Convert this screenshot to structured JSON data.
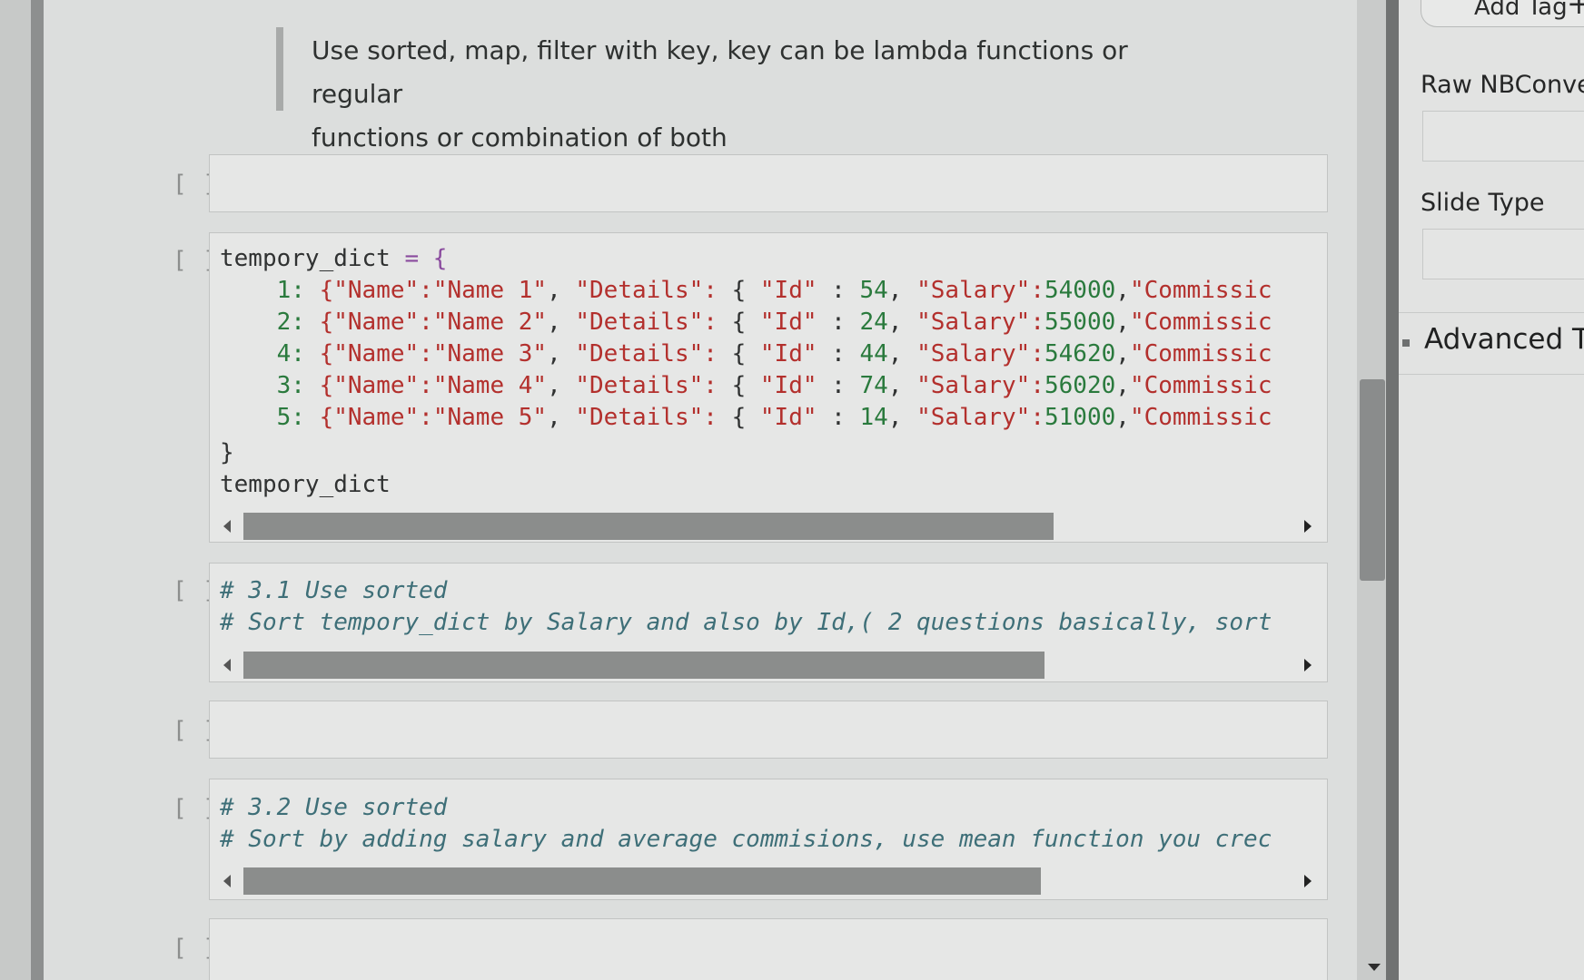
{
  "markdown": {
    "line1": "Use sorted, map, filter with key, key can be lambda functions or regular",
    "line2": "functions or combination of both"
  },
  "prompts": [
    "[ ]:",
    "[ ]:",
    "[ ]:",
    "[ ]:",
    "[ ]:",
    "[ ]:"
  ],
  "code_cell": {
    "line_open_a": "tempory_dict",
    "line_open_b": " = {",
    "rows": [
      {
        "key": "1:",
        "name": "\"Name 1\"",
        "id": "54",
        "salary": "54000"
      },
      {
        "key": "2:",
        "name": "\"Name 2\"",
        "id": "24",
        "salary": "55000"
      },
      {
        "key": "4:",
        "name": "\"Name 3\"",
        "id": "44",
        "salary": "54620"
      },
      {
        "key": "3:",
        "name": "\"Name 4\"",
        "id": "74",
        "salary": "56020"
      },
      {
        "key": "5:",
        "name": "\"Name 5\"",
        "id": "14",
        "salary": "51000"
      }
    ],
    "name_key": "{\"Name\":",
    "details_key": "\"Details\":",
    "brace": "{",
    "id_key": "\"Id\"",
    "colon": ":",
    "comma": ",",
    "salary_key": "\"Salary\":",
    "commission_key": "\"Commissic",
    "line_close": "}",
    "line_last": "tempory_dict"
  },
  "cell_31": {
    "line1": "# 3.1 Use sorted",
    "line2": "# Sort tempory_dict by Salary and also by Id,( 2 questions basically, sort"
  },
  "cell_32": {
    "line1": "# 3.2 Use sorted",
    "line2": "# Sort by adding salary and average commisions, use mean function you crec"
  },
  "right_panel": {
    "add_tag": "Add Tag",
    "add_tag_icon": "+",
    "raw_nbconvert": "Raw NBConver",
    "slide_type": "Slide Type",
    "advanced": "Advanced To"
  }
}
